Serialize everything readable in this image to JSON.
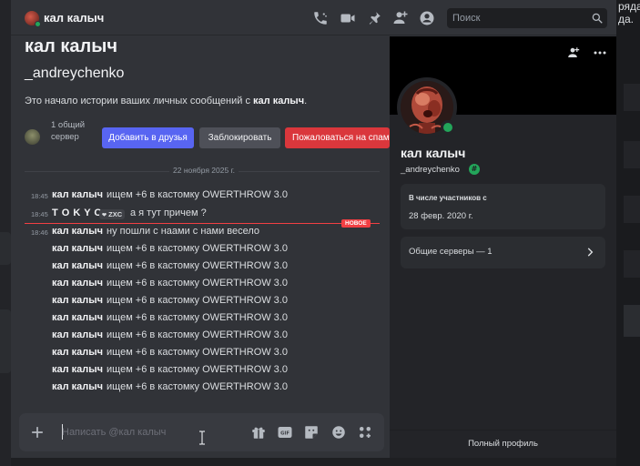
{
  "background": {
    "right_text": "ряда\nда."
  },
  "header": {
    "title": "кал калыч",
    "search_placeholder": "Поиск"
  },
  "intro": {
    "name": "кал калыч",
    "username": "_andreychenko",
    "text_prefix": "Это начало истории ваших личных сообщений с ",
    "text_name": "кал калыч",
    "text_suffix": ".",
    "mutual": "1 общий сервер",
    "add_friend": "Добавить в друзья",
    "block": "Заблокировать",
    "report": "Пожаловаться на спам"
  },
  "date_divider": "22 ноября 2025 г.",
  "new_badge": "НОВОЕ",
  "messages": [
    {
      "time": "18:45",
      "author": "кал калыч",
      "text": "ищем +6 в кастомку OWERTHROW 3.0"
    },
    {
      "time": "18:45",
      "author": "T O K Y O",
      "tag": "ZXC",
      "text": "а я тут причем ?"
    },
    {
      "time": "18:46",
      "author": "кал калыч",
      "text": "ну пошли с наами с нами весело"
    },
    {
      "time": "",
      "author": "кал калыч",
      "text": "ищем +6 в кастомку OWERTHROW 3.0"
    },
    {
      "time": "",
      "author": "кал калыч",
      "text": "ищем +6 в кастомку OWERTHROW 3.0"
    },
    {
      "time": "",
      "author": "кал калыч",
      "text": "ищем +6 в кастомку OWERTHROW 3.0"
    },
    {
      "time": "",
      "author": "кал калыч",
      "text": "ищем +6 в кастомку OWERTHROW 3.0"
    },
    {
      "time": "",
      "author": "кал калыч",
      "text": "ищем +6 в кастомку OWERTHROW 3.0"
    },
    {
      "time": "",
      "author": "кал калыч",
      "text": "ищем +6 в кастомку OWERTHROW 3.0"
    },
    {
      "time": "",
      "author": "кал калыч",
      "text": "ищем +6 в кастомку OWERTHROW 3.0"
    },
    {
      "time": "",
      "author": "кал калыч",
      "text": "ищем +6 в кастомку OWERTHROW 3.0"
    },
    {
      "time": "",
      "author": "кал калыч",
      "text": "ищем +6 в кастомку OWERTHROW 3.0"
    }
  ],
  "composer": {
    "placeholder": "Написать @кал калыч"
  },
  "profile": {
    "name": "кал калыч",
    "username": "_andreychenko",
    "badge": "#",
    "member_since_label": "В числе участников с",
    "member_since": "28 февр. 2020 г.",
    "mutual_servers": "Общие серверы — 1",
    "full_profile": "Полный профиль"
  },
  "colors": {
    "accent": "#5865f2",
    "danger": "#da373c",
    "online": "#23a55a",
    "new": "#f23f43"
  }
}
